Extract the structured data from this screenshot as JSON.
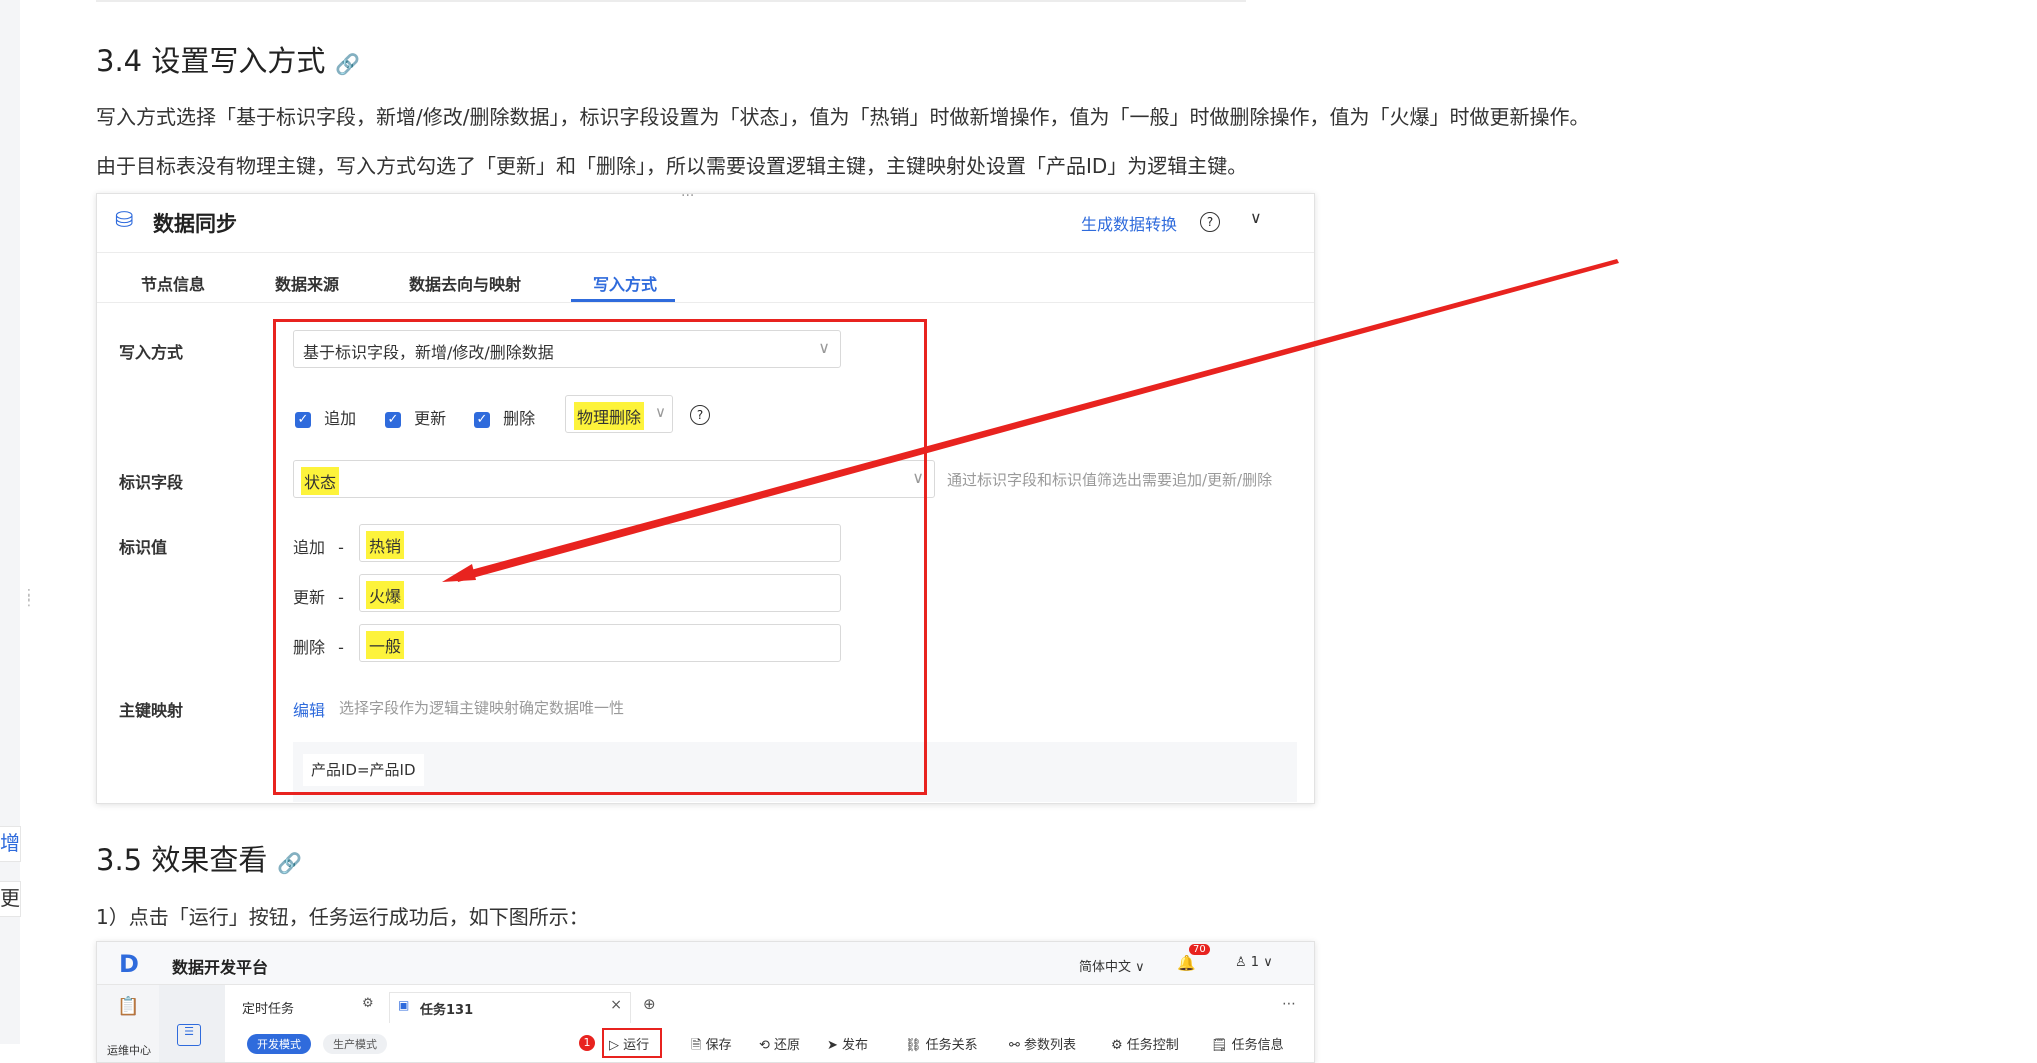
{
  "sidebar_snippets": [
    "增,",
    "更新"
  ],
  "section_34": {
    "title": "3.4 设置写入方式",
    "p1": "写入方式选择「基于标识字段，新增/修改/删除数据」，标识字段设置为「状态」，值为「热销」时做新增操作，值为「一般」时做删除操作，值为「火爆」时做更新操作。",
    "p2": "由于目标表没有物理主键，写入方式勾选了「更新」和「删除」，所以需要设置逻辑主键，主键映射处设置「产品ID」为逻辑主键。"
  },
  "shot1": {
    "title": "数据同步",
    "gen_link": "生成数据转换",
    "tabs": [
      "节点信息",
      "数据来源",
      "数据去向与映射",
      "写入方式"
    ],
    "active_tab": 3,
    "write_mode_label": "写入方式",
    "write_mode_value": "基于标识字段，新增/修改/删除数据",
    "checkboxes": [
      "追加",
      "更新",
      "删除"
    ],
    "delete_mode": "物理删除",
    "flag_field_label": "标识字段",
    "flag_field_value": "状态",
    "flag_field_hint": "通过标识字段和标识值筛选出需要追加/更新/删除",
    "flag_value_label": "标识值",
    "flag_values": [
      {
        "op": "追加",
        "sep": "-",
        "value": "热销"
      },
      {
        "op": "更新",
        "sep": "-",
        "value": "火爆"
      },
      {
        "op": "删除",
        "sep": "-",
        "value": "一般"
      }
    ],
    "pk_label": "主键映射",
    "pk_edit": "编辑",
    "pk_hint": "选择字段作为逻辑主键映射确定数据唯一性",
    "pk_value": "产品ID=产品ID",
    "accent": "#2f6bdc",
    "annotation_color": "#e8231f"
  },
  "section_35": {
    "title": "3.5 效果查看",
    "p1": "1）点击「运行」按钮，任务运行成功后，如下图所示："
  },
  "shot2": {
    "app_title": "数据开发平台",
    "lang": "简体中文",
    "bell_count": "70",
    "user": "1",
    "side_label": "运维中心",
    "tabs": [
      "定时任务",
      "任务131"
    ],
    "modes": [
      "开发模式",
      "生产模式"
    ],
    "badge": "1",
    "toolbar": [
      "运行",
      "保存",
      "还原",
      "发布",
      "任务关系",
      "参数列表",
      "任务控制",
      "任务信息"
    ]
  }
}
